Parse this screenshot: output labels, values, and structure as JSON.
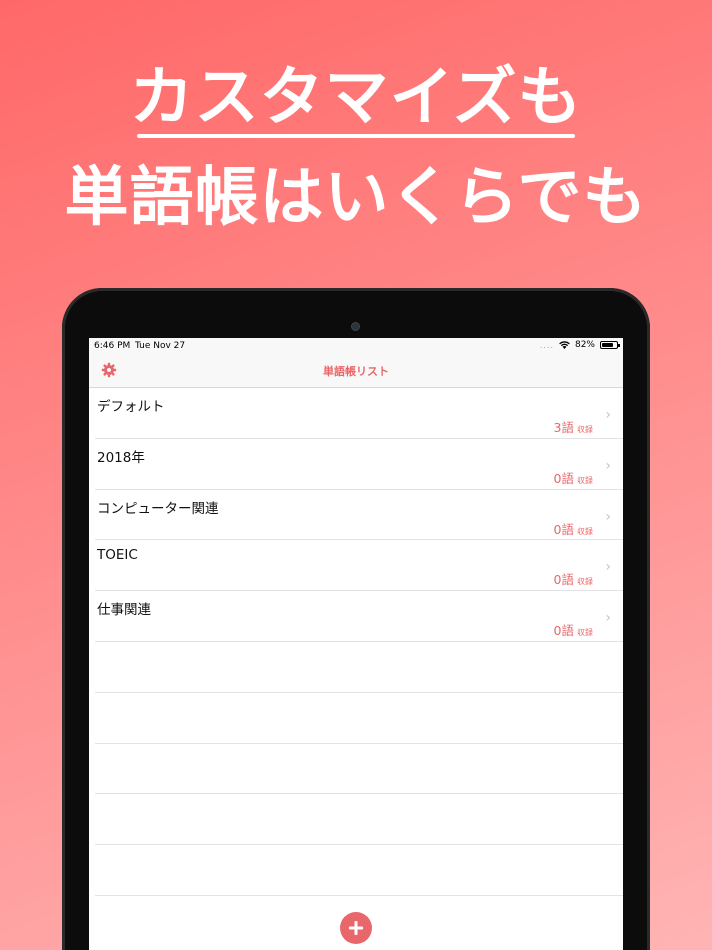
{
  "headline": {
    "line1": "カスタマイズも",
    "line2": "単語帳はいくらでも"
  },
  "status_bar": {
    "time": "6:46 PM",
    "date": "Tue Nov 27",
    "signal": "....",
    "battery_percent": "82%",
    "battery_level": 0.82
  },
  "nav": {
    "title": "単語帳リスト",
    "settings_icon": "gear-icon"
  },
  "wordbooks": [
    {
      "title": "デフォルト",
      "count": "3語",
      "unit": "収録"
    },
    {
      "title": "2018年",
      "count": "0語",
      "unit": "収録"
    },
    {
      "title": "コンピューター関連",
      "count": "0語",
      "unit": "収録"
    },
    {
      "title": "TOEIC",
      "count": "0語",
      "unit": "収録"
    },
    {
      "title": "仕事関連",
      "count": "0語",
      "unit": "収録"
    }
  ],
  "chevron": "›",
  "add_icon": "plus-icon",
  "colors": {
    "accent": "#e8676a",
    "background_top": "#ff6868",
    "background_bottom": "#ffb4b4"
  }
}
